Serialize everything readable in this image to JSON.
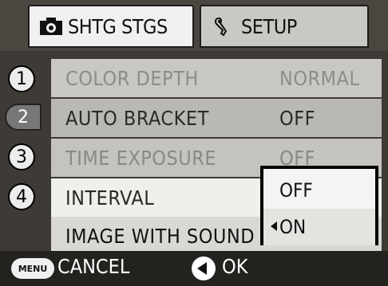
{
  "tabs": {
    "shooting": {
      "label": "SHTG STGS",
      "icon": "camera-icon"
    },
    "setup": {
      "label": "SETUP",
      "icon": "wrench-icon"
    }
  },
  "pages": [
    {
      "number": "1",
      "active": false
    },
    {
      "number": "2",
      "active": true
    },
    {
      "number": "3",
      "active": false
    },
    {
      "number": "4",
      "active": false
    }
  ],
  "menu": [
    {
      "name": "COLOR DEPTH",
      "value": "NORMAL",
      "state": "disabled"
    },
    {
      "name": "AUTO BRACKET",
      "value": "OFF",
      "state": "normal"
    },
    {
      "name": "TIME EXPOSURE",
      "value": "OFF",
      "state": "disabled"
    },
    {
      "name": "INTERVAL",
      "value": "",
      "state": "normal"
    },
    {
      "name": "IMAGE WITH SOUND",
      "value": "",
      "state": "selected"
    }
  ],
  "popup": {
    "options": [
      "OFF",
      "ON"
    ],
    "selected": "ON"
  },
  "footer": {
    "menu_button": "MENU",
    "cancel_label": "CANCEL",
    "ok_label": "OK"
  }
}
